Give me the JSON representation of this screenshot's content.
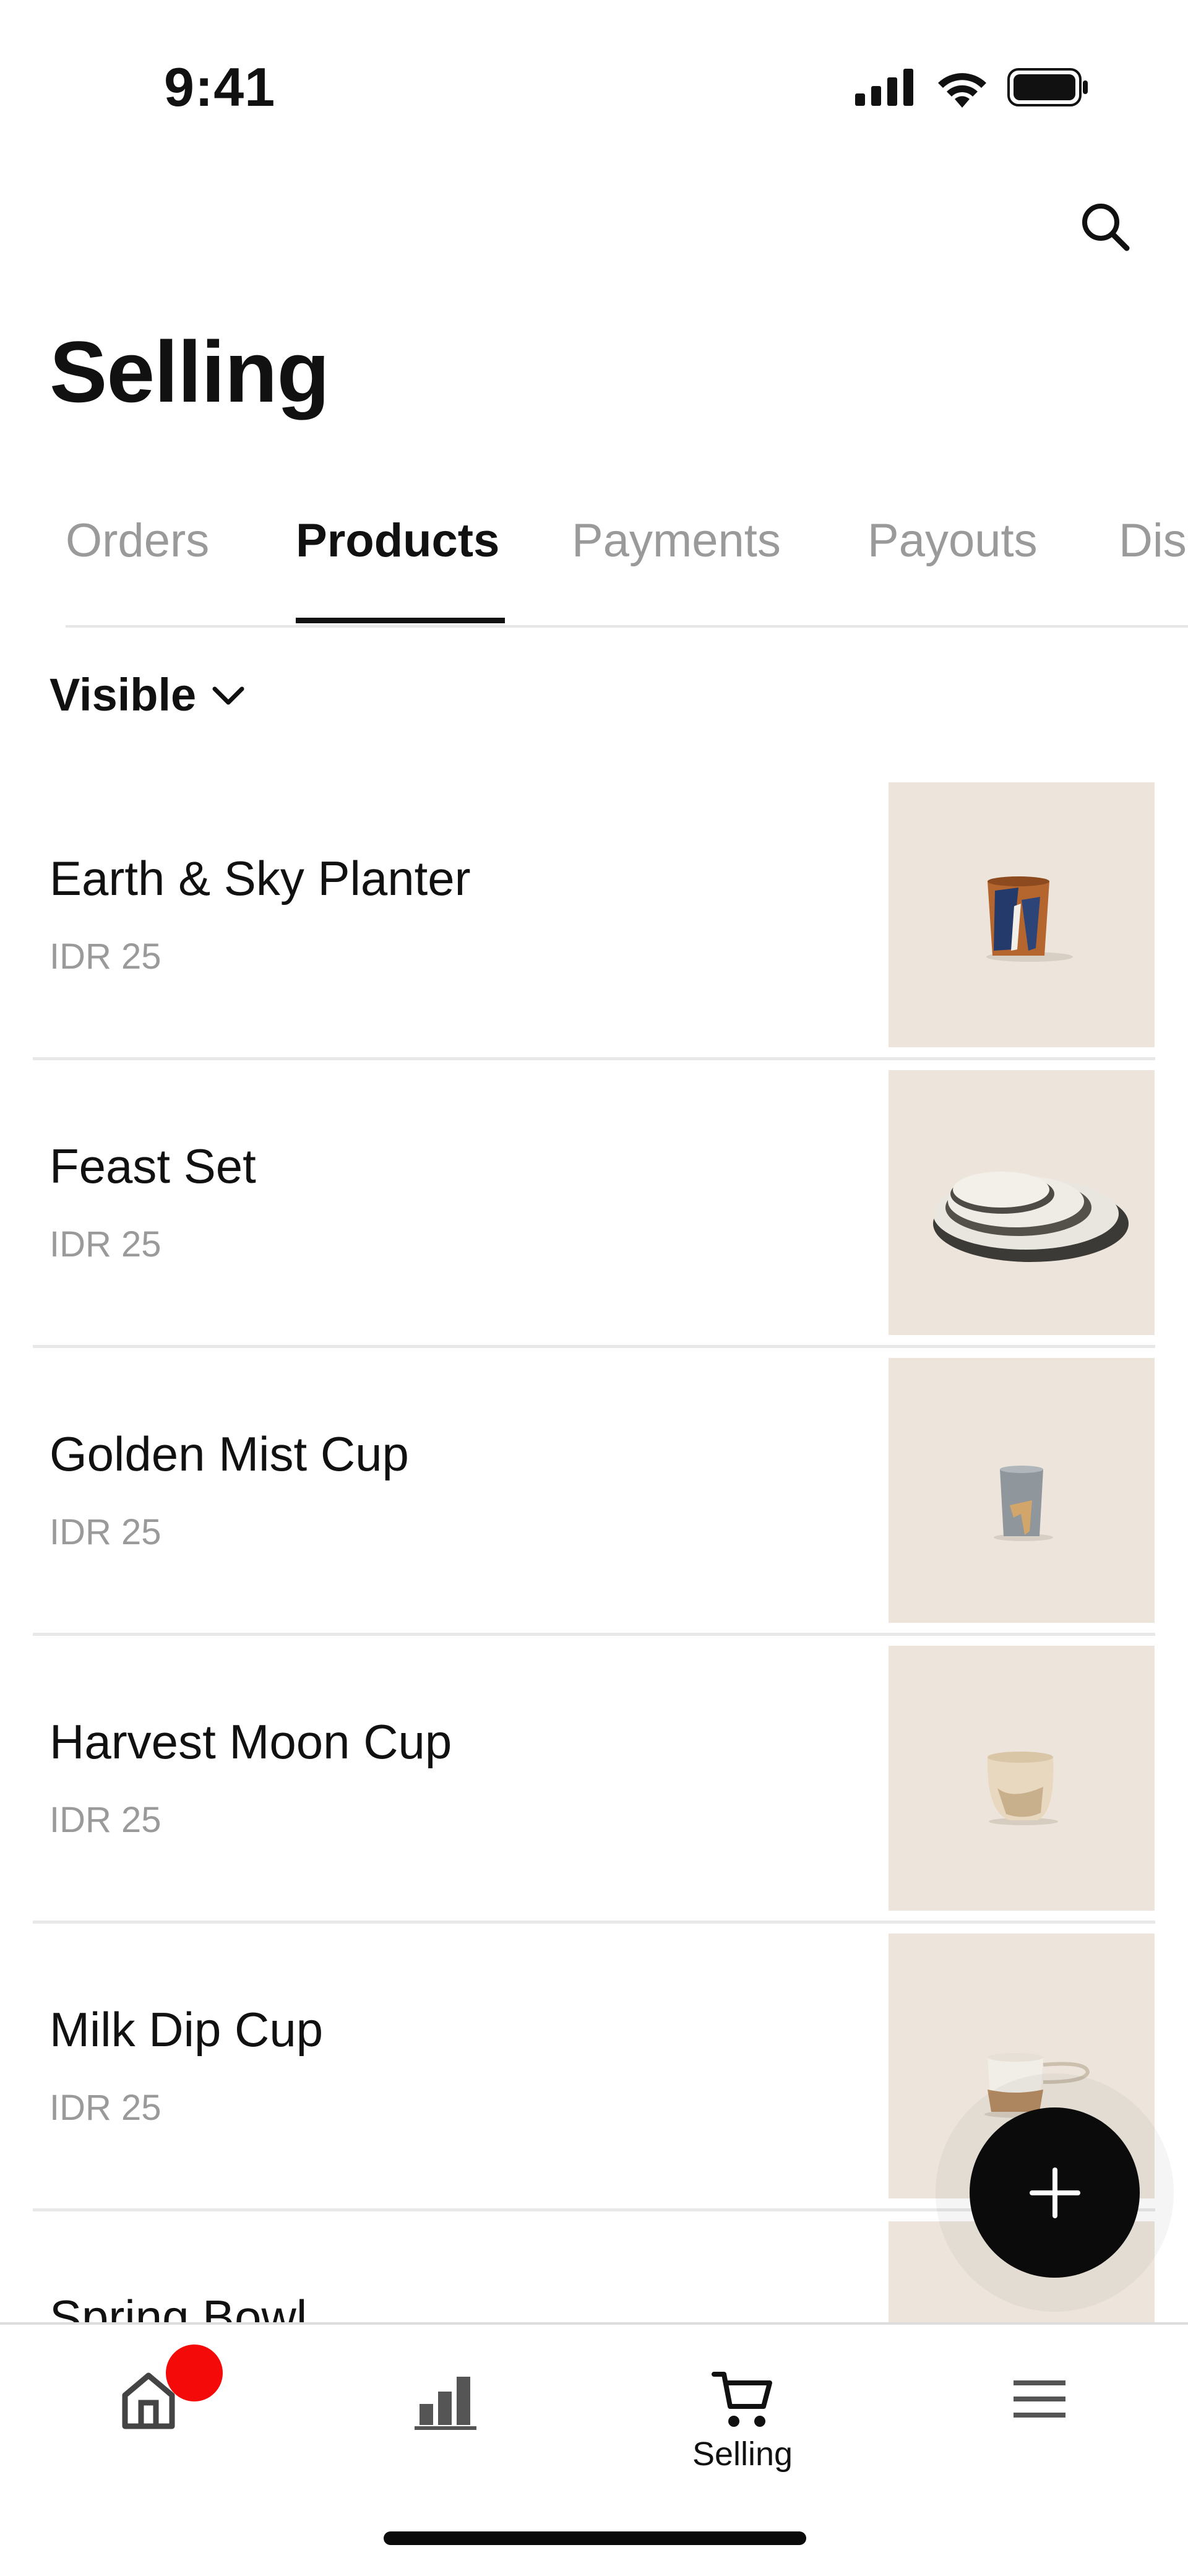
{
  "status_bar": {
    "time": "9:41"
  },
  "header": {
    "title": "Selling"
  },
  "tabs": [
    {
      "label": "Orders",
      "active": false
    },
    {
      "label": "Products",
      "active": true
    },
    {
      "label": "Payments",
      "active": false
    },
    {
      "label": "Payouts",
      "active": false
    },
    {
      "label": "Dis",
      "active": false
    }
  ],
  "filter": {
    "label": "Visible"
  },
  "products": [
    {
      "name": "Earth & Sky Planter",
      "price": "IDR 25"
    },
    {
      "name": "Feast Set",
      "price": "IDR 25"
    },
    {
      "name": "Golden Mist Cup",
      "price": "IDR 25"
    },
    {
      "name": "Harvest Moon Cup",
      "price": "IDR 25"
    },
    {
      "name": "Milk Dip Cup",
      "price": "IDR 25"
    },
    {
      "name": "Spring Bowl",
      "price": ""
    }
  ],
  "bottom_nav": {
    "items": [
      {
        "icon": "home-icon",
        "label": "",
        "badge": true
      },
      {
        "icon": "bar-chart-icon",
        "label": ""
      },
      {
        "icon": "cart-icon",
        "label": "Selling",
        "active": true
      },
      {
        "icon": "menu-icon",
        "label": ""
      }
    ]
  },
  "colors": {
    "accent": "#111111",
    "muted": "#9a9a9a",
    "thumb_bg": "#ede5dc",
    "badge": "#f50a0a"
  }
}
